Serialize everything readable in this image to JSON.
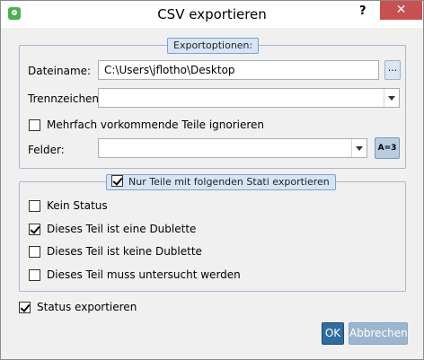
{
  "window": {
    "title": "CSV exportieren",
    "help_label": "?",
    "close_label": "✕"
  },
  "export_options": {
    "legend": "Exportoptionen:",
    "filename_label": "Dateiname:",
    "filename_value": "C:\\Users\\jflotho\\Desktop",
    "browse_label": "...",
    "separator_label": "Trennzeichen:",
    "separator_value": "",
    "ignore_duplicates_label": "Mehrfach vorkommende Teile ignorieren",
    "ignore_duplicates_checked": false,
    "fields_label": "Felder:",
    "fields_value": "",
    "fields_button_label": "A=3"
  },
  "status_filter": {
    "legend": "Nur Teile mit folgenden Stati exportieren",
    "enabled": true,
    "options": [
      {
        "label": "Kein Status",
        "checked": false
      },
      {
        "label": "Dieses Teil ist eine Dublette",
        "checked": true
      },
      {
        "label": "Dieses Teil ist keine Dublette",
        "checked": false
      },
      {
        "label": "Dieses Teil muss untersucht werden",
        "checked": false
      }
    ]
  },
  "export_status": {
    "label": "Status exportieren",
    "checked": true
  },
  "buttons": {
    "ok": "OK",
    "cancel": "Abbrechen"
  }
}
